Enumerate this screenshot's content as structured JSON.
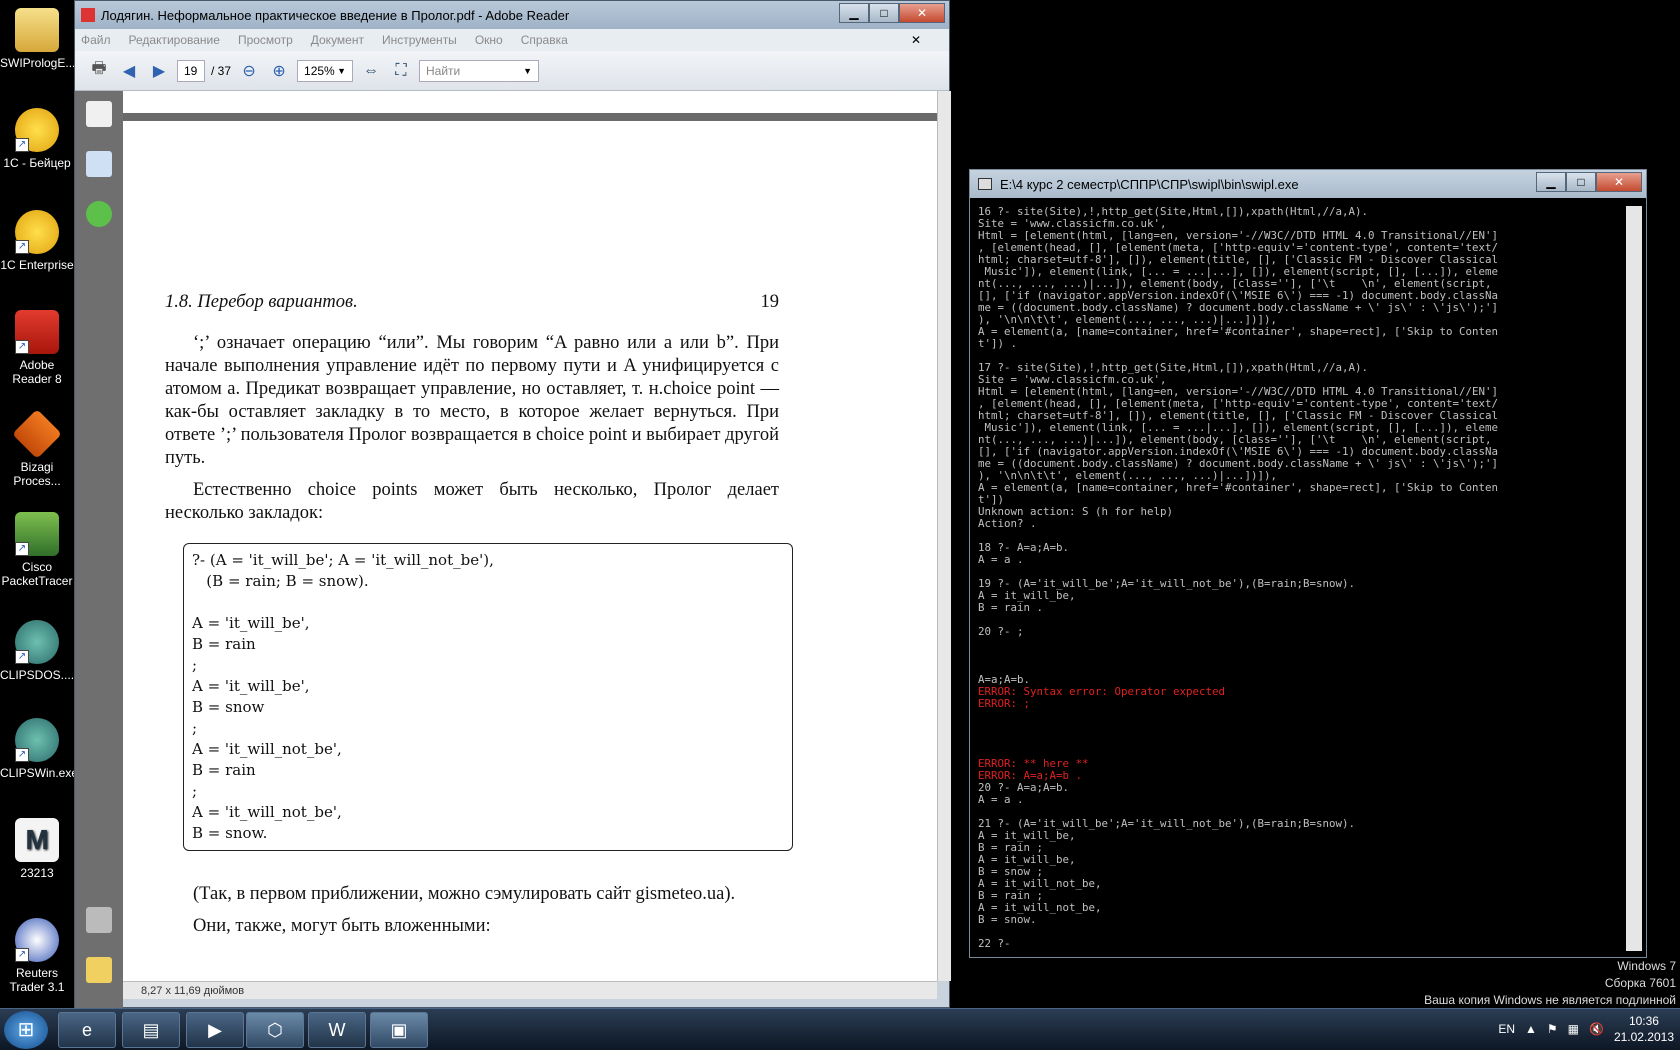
{
  "desktop": {
    "icons": [
      {
        "label": "SWIPrologE...",
        "icon": "folder-icon"
      },
      {
        "label": "1С - Бейцер",
        "icon": "1c-icon"
      },
      {
        "label": "1C Enterprise",
        "icon": "1c-icon"
      },
      {
        "label": "Adobe Reader 8",
        "icon": "pdf-icon"
      },
      {
        "label": "Bizagi Proces...",
        "icon": "bizagi-icon"
      },
      {
        "label": "Cisco PacketTracer",
        "icon": "cisco-icon"
      },
      {
        "label": "CLIPSDOS....",
        "icon": "clips-icon"
      },
      {
        "label": "CLIPSWin.exe",
        "icon": "clips-icon"
      },
      {
        "label": "23213",
        "icon": "m-file-icon"
      },
      {
        "label": "Reuters Trader 3.1",
        "icon": "reuters-icon"
      }
    ]
  },
  "reader": {
    "title": "Лодягин. Неформальное практическое введение в Пролог.pdf - Adobe Reader",
    "menu": [
      "Файл",
      "Редактирование",
      "Просмотр",
      "Документ",
      "Инструменты",
      "Окно",
      "Справка"
    ],
    "page_current": "19",
    "page_total": "/ 37",
    "zoom": "125%",
    "find_placeholder": "Найти",
    "page_size": "8,27 x 11,69 дюймов",
    "doc": {
      "section": "1.8.   Перебор вариантов.",
      "page_number": "19",
      "para1": "‘;’ означает операцию “или”. Мы говорим “A равно или a или b”. При начале выполнения управление идёт по первому пути и A унифицируется с атомом a. Предикат возвращает управление, но оставляет, т. н.choice point — как-бы оставляет закладку в то место, в которое желает вернуться. При ответе ’;’ пользователя Пролог возвращается в choice point и выбирает другой путь.",
      "para2": "Естественно choice points может быть несколько, Пролог делает несколько закладок:",
      "code": "?- (A = 'it_will_be'; A = 'it_will_not_be'),\n   (B = rain; B = snow).\n\nA = 'it_will_be',\nB = rain\n;\nA = 'it_will_be',\nB = snow\n;\nA = 'it_will_not_be',\nB = rain\n;\nA = 'it_will_not_be',\nB = snow.",
      "para3": "(Так, в первом приближении, можно сэмулировать сайт gismeteo.ua).",
      "para4": "Они, также, могут быть вложенными:"
    }
  },
  "console": {
    "title": "E:\\4 курс 2 семестр\\СППР\\СПР\\swipl\\bin\\swipl.exe",
    "lines_a": "16 ?- site(Site),!,http_get(Site,Html,[]),xpath(Html,//a,A).\nSite = 'www.classicfm.co.uk',\nHtml = [element(html, [lang=en, version='-//W3C//DTD HTML 4.0 Transitional//EN']\n, [element(head, [], [element(meta, ['http-equiv'='content-type', content='text/\nhtml; charset=utf-8'], []), element(title, [], ['Classic FM - Discover Classical\n Music']), element(link, [... = ...|...], []), element(script, [], [...]), eleme\nnt(..., ..., ...)|...]), element(body, [class=''], ['\\t    \\n', element(script,\n[], ['if (navigator.appVersion.indexOf(\\'MSIE 6\\') === -1) document.body.classNa\nme = ((document.body.className) ? document.body.className + \\' js\\' : \\'js\\');']\n), '\\n\\n\\t\\t', element(..., ..., ...)|...])]),\nA = element(a, [name=container, href='#container', shape=rect], ['Skip to Conten\nt']) .\n\n17 ?- site(Site),!,http_get(Site,Html,[]),xpath(Html,//a,A).\nSite = 'www.classicfm.co.uk',\nHtml = [element(html, [lang=en, version='-//W3C//DTD HTML 4.0 Transitional//EN']\n, [element(head, [], [element(meta, ['http-equiv'='content-type', content='text/\nhtml; charset=utf-8'], []), element(title, [], ['Classic FM - Discover Classical\n Music']), element(link, [... = ...|...], []), element(script, [], [...]), eleme\nnt(..., ..., ...)|...]), element(body, [class=''], ['\\t    \\n', element(script,\n[], ['if (navigator.appVersion.indexOf(\\'MSIE 6\\') === -1) document.body.classNa\nme = ((document.body.className) ? document.body.className + \\' js\\' : \\'js\\');']\n), '\\n\\n\\t\\t', element(..., ..., ...)|...])]),\nA = element(a, [name=container, href='#container', shape=rect], ['Skip to Conten\nt'])\nUnknown action: S (h for help)\nAction? .\n\n18 ?- A=a;A=b.\nA = a .\n\n19 ?- (A='it_will_be';A='it_will_not_be'),(B=rain;B=snow).\nA = it_will_be,\nB = rain .\n\n20 ?- ;\n\n\n\nA=a;A=b.",
    "err1": "ERROR: Syntax error: Operator expected\nERROR: ;",
    "err2": "ERROR: ** here **\nERROR: A=a;A=b .",
    "lines_b": "20 ?- A=a;A=b.\nA = a .\n\n21 ?- (A='it_will_be';A='it_will_not_be'),(B=rain;B=snow).\nA = it_will_be,\nB = rain ;\nA = it_will_be,\nB = snow ;\nA = it_will_not_be,\nB = rain ;\nA = it_will_not_be,\nB = snow.\n\n22 ?-"
  },
  "watermark": {
    "line1": "Windows 7",
    "line2": "Сборка 7601",
    "line3": "Ваша копия Windows не является подлинной"
  },
  "taskbar": {
    "lang": "EN",
    "time": "10:36",
    "date": "21.02.2013"
  }
}
